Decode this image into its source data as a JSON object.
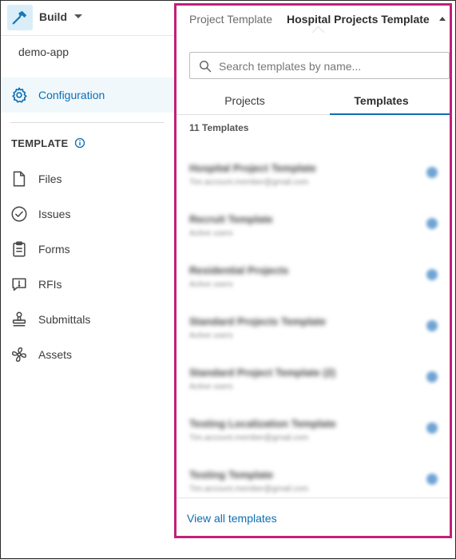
{
  "app": {
    "name": "Build",
    "icon": "hammer-icon"
  },
  "project": {
    "name": "demo-app"
  },
  "sidebar": {
    "active_item": {
      "label": "Configuration",
      "icon": "gear-icon"
    },
    "section_title": "TEMPLATE",
    "items": [
      {
        "label": "Files",
        "icon": "file-icon"
      },
      {
        "label": "Issues",
        "icon": "check-circle-icon"
      },
      {
        "label": "Forms",
        "icon": "clipboard-icon"
      },
      {
        "label": "RFIs",
        "icon": "speech-bubble-icon"
      },
      {
        "label": "Submittals",
        "icon": "stamp-icon"
      },
      {
        "label": "Assets",
        "icon": "fan-icon"
      }
    ]
  },
  "panel": {
    "crumb_label": "Project Template",
    "crumb_value": "Hospital Projects Template",
    "search_placeholder": "Search templates by name...",
    "tabs": [
      {
        "label": "Projects"
      },
      {
        "label": "Templates"
      }
    ],
    "count": "11 Templates",
    "templates": [
      {
        "name": "Hospital Project Template",
        "sub": "Tim.account.member@gmail.com"
      },
      {
        "name": "Recruit Template",
        "sub": "Active users"
      },
      {
        "name": "Residential Projects",
        "sub": "Active users"
      },
      {
        "name": "Standard Projects Template",
        "sub": "Active users"
      },
      {
        "name": "Standard Project Template (2)",
        "sub": "Active users"
      },
      {
        "name": "Testing Localization Template",
        "sub": "Tim.account.member@gmail.com"
      },
      {
        "name": "Testing Template",
        "sub": "Tim.account.member@gmail.com"
      }
    ],
    "view_all": "View all templates"
  },
  "colors": {
    "accent": "#0b6fb2",
    "highlight_border": "#c21f7a",
    "active_bg": "#f1f8fc"
  }
}
